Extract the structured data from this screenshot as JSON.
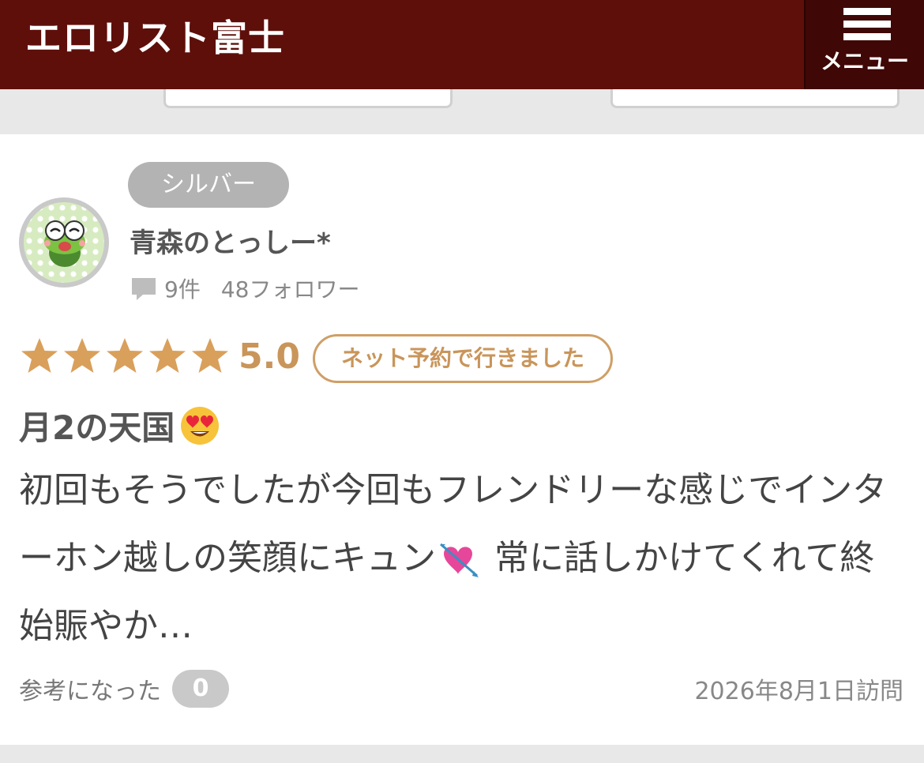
{
  "header": {
    "title": "エロリスト富士",
    "menu_label": "メニュー",
    "background": "#5e0f0a",
    "menu_background": "#3f0705"
  },
  "review": {
    "reviewer": {
      "rank": "シルバー",
      "name": "青森のとっしー*",
      "review_count": "9件",
      "followers": "48フォロワー",
      "avatar_icon": "frog-avatar"
    },
    "rating": {
      "stars": 5,
      "value": "5.0",
      "star_color": "#d9a05b"
    },
    "booking_badge": "ネット予約で行きました",
    "title": "月2の天国",
    "title_emoji": "😍",
    "body_part1": "初回もそうでしたが今回もフレンドリーな感じでインターホン越しの笑顔にキュン",
    "body_emoji": "💘",
    "body_part2": " 常に話しかけてくれて終始賑やか…",
    "helpful_label": "参考になった",
    "helpful_count": "0",
    "visit_date": "2026年8月1日訪問"
  }
}
